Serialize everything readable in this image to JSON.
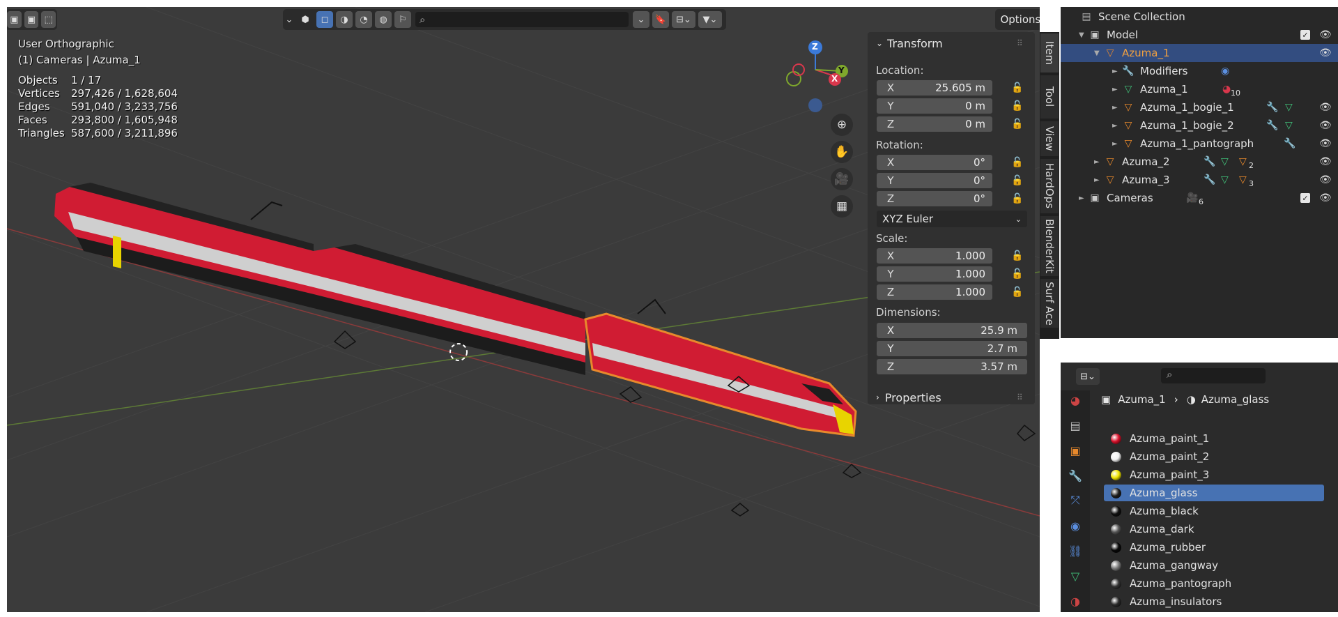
{
  "viewport": {
    "view_name": "User Orthographic",
    "collection_info": "(1) Cameras | Azuma_1",
    "stats": [
      {
        "label": "Objects",
        "value": "1 / 17"
      },
      {
        "label": "Vertices",
        "value": "297,426 / 1,628,604"
      },
      {
        "label": "Edges",
        "value": "591,040 / 3,233,756"
      },
      {
        "label": "Faces",
        "value": "293,800 / 1,605,948"
      },
      {
        "label": "Triangles",
        "value": "587,600 / 3,211,896"
      }
    ],
    "options_label": "Options",
    "gizmo_axes": {
      "z": "Z",
      "y": "Y",
      "x": "X"
    }
  },
  "npanel": {
    "transform_title": "Transform",
    "location_label": "Location:",
    "location": [
      {
        "axis": "X",
        "value": "25.605 m"
      },
      {
        "axis": "Y",
        "value": "0 m"
      },
      {
        "axis": "Z",
        "value": "0 m"
      }
    ],
    "rotation_label": "Rotation:",
    "rotation": [
      {
        "axis": "X",
        "value": "0°"
      },
      {
        "axis": "Y",
        "value": "0°"
      },
      {
        "axis": "Z",
        "value": "0°"
      }
    ],
    "rotation_mode": "XYZ Euler",
    "scale_label": "Scale:",
    "scale": [
      {
        "axis": "X",
        "value": "1.000"
      },
      {
        "axis": "Y",
        "value": "1.000"
      },
      {
        "axis": "Z",
        "value": "1.000"
      }
    ],
    "dimensions_label": "Dimensions:",
    "dimensions": [
      {
        "axis": "X",
        "value": "25.9 m"
      },
      {
        "axis": "Y",
        "value": "2.7 m"
      },
      {
        "axis": "Z",
        "value": "3.57 m"
      }
    ],
    "properties_title": "Properties"
  },
  "tabs": [
    "Item",
    "Tool",
    "View",
    "HardOps",
    "BlenderKit",
    "Surf Ace"
  ],
  "outliner": {
    "root": "Scene Collection",
    "rows": [
      {
        "label": "Model"
      },
      {
        "label": "Azuma_1"
      },
      {
        "label": "Modifiers"
      },
      {
        "label": "Azuma_1",
        "badge": "10"
      },
      {
        "label": "Azuma_1_bogie_1"
      },
      {
        "label": "Azuma_1_bogie_2"
      },
      {
        "label": "Azuma_1_pantograph"
      },
      {
        "label": "Azuma_2",
        "badge": "2"
      },
      {
        "label": "Azuma_3",
        "badge": "3"
      },
      {
        "label": "Cameras",
        "badge": "6"
      }
    ]
  },
  "properties": {
    "breadcrumb_object": "Azuma_1",
    "breadcrumb_material": "Azuma_glass",
    "materials": [
      {
        "name": "Azuma_paint_1",
        "color": "#d8102a"
      },
      {
        "name": "Azuma_paint_2",
        "color": "#f2f2f2"
      },
      {
        "name": "Azuma_paint_3",
        "color": "#f2e600"
      },
      {
        "name": "Azuma_glass",
        "color": "#1e1e1e"
      },
      {
        "name": "Azuma_black",
        "color": "#101010"
      },
      {
        "name": "Azuma_dark",
        "color": "#555555"
      },
      {
        "name": "Azuma_rubber",
        "color": "#080808"
      },
      {
        "name": "Azuma_gangway",
        "color": "#7a7a7a"
      },
      {
        "name": "Azuma_pantograph",
        "color": "#333333"
      },
      {
        "name": "Azuma_insulators",
        "color": "#2a2a2a"
      }
    ]
  },
  "colors": {
    "selection_blue": "#4772b3",
    "outliner_selected": "#334d80",
    "object_orange": "#e8892c",
    "train_red": "#d01c33",
    "train_yellow": "#e8d400"
  }
}
